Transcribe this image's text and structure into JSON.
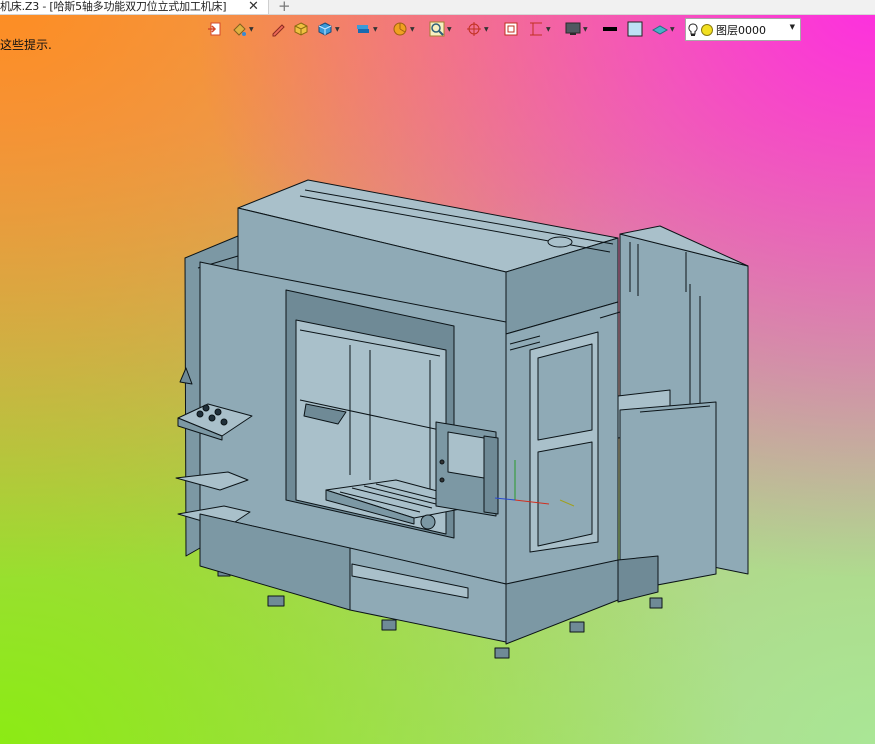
{
  "tab": {
    "title": "机床.Z3 - [哈斯5轴多功能双刀位立式加工机床]",
    "close_glyph": "✕",
    "add_glyph": "+"
  },
  "hint": {
    "text": "这些提示."
  },
  "toolbar": {
    "layer": {
      "name": "图层0000"
    },
    "icons": [
      "exit-icon",
      "paint-bucket-icon",
      "pen-icon",
      "solid-cube-icon",
      "box-shade-icon",
      "stack-icon",
      "pie-icon",
      "zoom-icon",
      "rotate-axis-icon",
      "frame-icon",
      "section-icon",
      "monitor-icon",
      "line-style-icon",
      "color-swatch-icon",
      "material-icon",
      "lightbulb-icon",
      "layer-visible-icon"
    ]
  },
  "colors": {
    "model_fill": "#8faab6",
    "model_light": "#a9c0ca",
    "model_dark": "#6f8a96",
    "edge": "#0c1418",
    "dropdown_bg": "#ffffff"
  }
}
